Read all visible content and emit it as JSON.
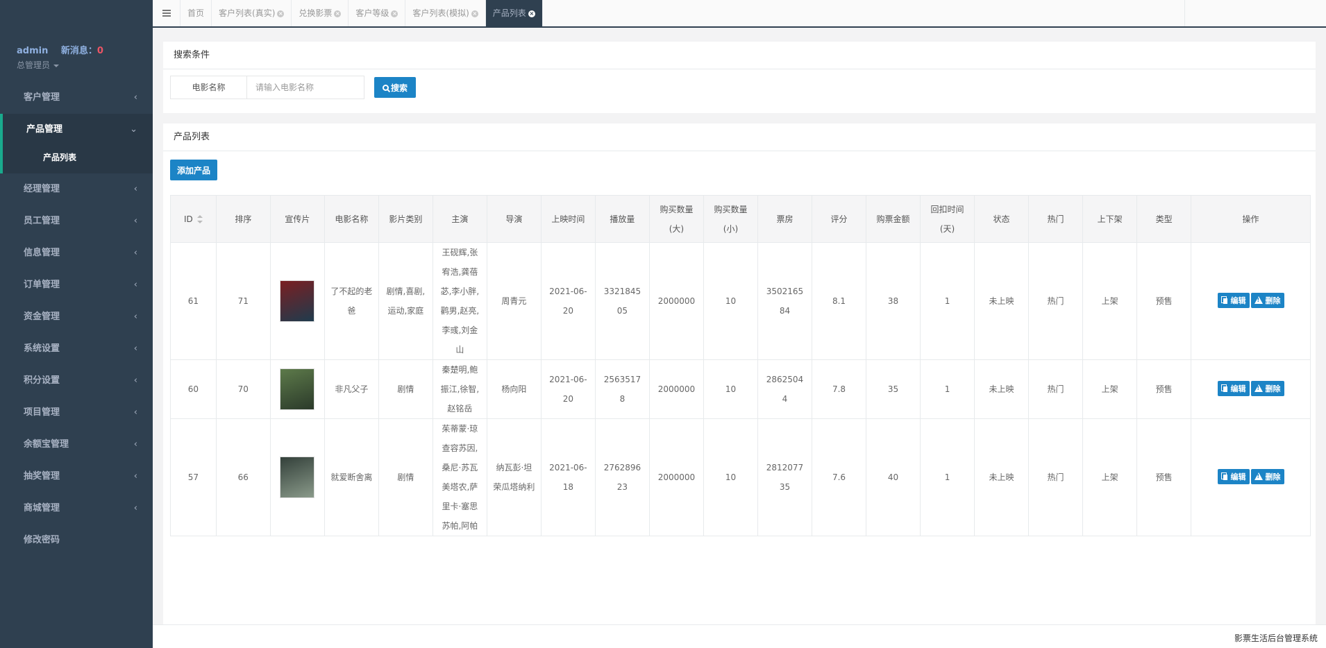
{
  "sidebar": {
    "user": "admin",
    "message_label": "新消息：",
    "message_count": "0",
    "role": "总管理员",
    "menu": [
      {
        "label": "客户管理"
      },
      {
        "label": "产品管理",
        "open": true,
        "sub": "产品列表"
      },
      {
        "label": "经理管理"
      },
      {
        "label": "员工管理"
      },
      {
        "label": "信息管理"
      },
      {
        "label": "订单管理"
      },
      {
        "label": "资金管理"
      },
      {
        "label": "系统设置"
      },
      {
        "label": "积分设置"
      },
      {
        "label": "项目管理"
      },
      {
        "label": "余额宝管理"
      },
      {
        "label": "抽奖管理"
      },
      {
        "label": "商城管理"
      },
      {
        "label": "修改密码"
      }
    ]
  },
  "tabs": [
    {
      "label": "首页",
      "closable": false
    },
    {
      "label": "客户列表(真实)",
      "closable": true
    },
    {
      "label": "兑换影票",
      "closable": true
    },
    {
      "label": "客户等级",
      "closable": true
    },
    {
      "label": "客户列表(模拟)",
      "closable": true
    },
    {
      "label": "产品列表",
      "closable": true,
      "active": true
    }
  ],
  "search": {
    "title": "搜索条件",
    "field_label": "电影名称",
    "placeholder": "请输入电影名称",
    "button": "搜索"
  },
  "list": {
    "title": "产品列表",
    "add_button": "添加产品",
    "columns": [
      "ID",
      "排序",
      "宣传片",
      "电影名称",
      "影片类别",
      "主演",
      "导演",
      "上映时间",
      "播放量",
      "购买数量(大)",
      "购买数量(小)",
      "票房",
      "评分",
      "购票金额",
      "回扣时间(天)",
      "状态",
      "热门",
      "上下架",
      "类型",
      "操作"
    ],
    "edit_label": "编辑",
    "delete_label": "删除",
    "rows": [
      {
        "id": "61",
        "sort": "71",
        "name": "了不起的老爸",
        "category": "剧情,喜剧,运动,家庭",
        "cast": "王砚辉,张宥浩,龚蓓苾,李小胖,鹳男,赵亮,李彧,刘金山",
        "director": "周青元",
        "release": "2021-06-20",
        "plays": "332184505",
        "buy_big": "2000000",
        "buy_small": "10",
        "box_office": "350216584",
        "rating": "8.1",
        "price": "38",
        "rebate_days": "1",
        "status": "未上映",
        "hot": "热门",
        "shelf": "上架",
        "type": "预售",
        "poster_colors": [
          "#7a1f22",
          "#1f3b4d"
        ]
      },
      {
        "id": "60",
        "sort": "70",
        "name": "非凡父子",
        "category": "剧情",
        "cast": "秦楚明,鲍振江,徐智,赵铭岳",
        "director": "杨向阳",
        "release": "2021-06-20",
        "plays": "25635178",
        "buy_big": "2000000",
        "buy_small": "10",
        "box_office": "28625044",
        "rating": "7.8",
        "price": "35",
        "rebate_days": "1",
        "status": "未上映",
        "hot": "热门",
        "shelf": "上架",
        "type": "预售",
        "poster_colors": [
          "#5d7a4a",
          "#2b3a2a"
        ]
      },
      {
        "id": "57",
        "sort": "66",
        "name": "就爱断舍离",
        "category": "剧情",
        "cast": "茱蒂蒙·琼查容苏因,桑尼·苏瓦美塔农,萨里卡·塞思苏帕,阿帕",
        "director": "纳瓦彭·坦荣瓜塔纳利",
        "release": "2021-06-18",
        "plays": "276289623",
        "buy_big": "2000000",
        "buy_small": "10",
        "box_office": "281207735",
        "rating": "7.6",
        "price": "40",
        "rebate_days": "1",
        "status": "未上映",
        "hot": "热门",
        "shelf": "上架",
        "type": "预售",
        "poster_colors": [
          "#33403a",
          "#8a9a8a"
        ]
      }
    ]
  },
  "footer": {
    "text": "影票生活后台管理系统"
  }
}
